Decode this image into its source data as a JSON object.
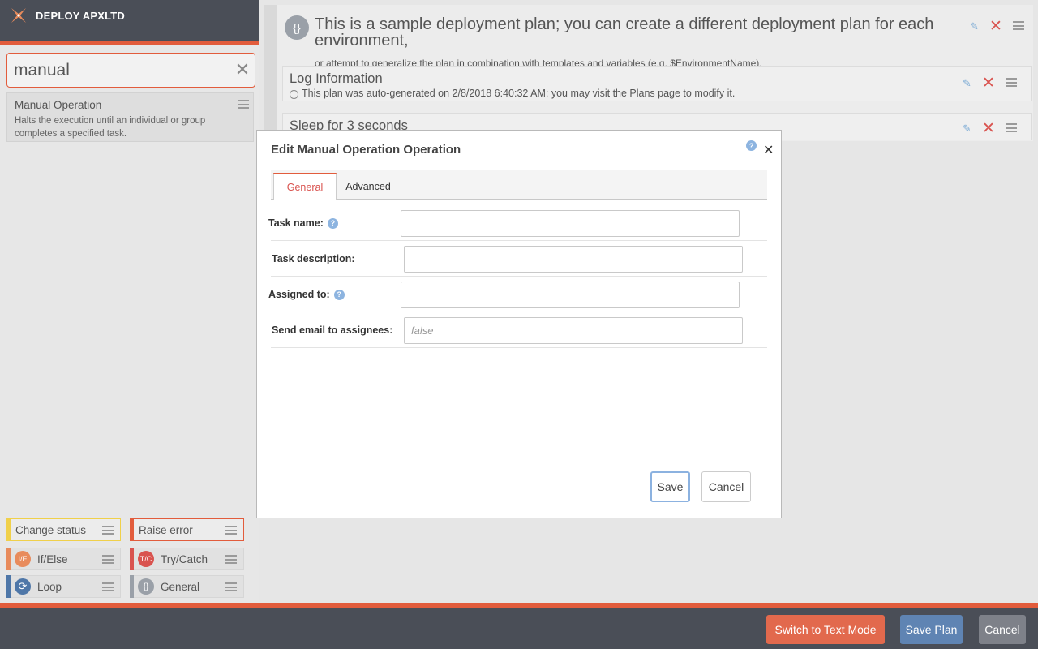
{
  "app": {
    "brand": "DEPLOY APXLTD"
  },
  "search": {
    "value": "manual",
    "clear_icon": "close-icon"
  },
  "results": [
    {
      "title": "Manual Operation",
      "description": "Halts the execution until an individual or group completes a specified task."
    }
  ],
  "palette": [
    {
      "label": "Change status",
      "color": "#f0d04a",
      "icon": null
    },
    {
      "label": "Raise error",
      "color": "#e25c3c",
      "icon": null
    },
    {
      "label": "If/Else",
      "color": "#e88b5c",
      "icon": "I/E"
    },
    {
      "label": "Try/Catch",
      "color": "#d9534f",
      "icon": "T/C"
    },
    {
      "label": "Loop",
      "color": "#4f77a8",
      "icon": "loop"
    },
    {
      "label": "General",
      "color": "#9aa0a8",
      "icon": "{}"
    }
  ],
  "plan": {
    "title": "This is a sample deployment plan; you can create a different deployment plan for each environment,",
    "subtitle": "or attempt to generalize the plan in combination with templates and variables (e.g. $EnvironmentName).",
    "operations": [
      {
        "title": "Log Information",
        "subtitle": "This plan was auto-generated on 2/8/2018 6:40:32 AM; you may visit the Plans page to modify it."
      },
      {
        "title": "Sleep for 3 seconds",
        "subtitle": ""
      }
    ]
  },
  "modal": {
    "title": "Edit Manual Operation Operation",
    "tabs": [
      "General",
      "Advanced"
    ],
    "active_tab": "General",
    "fields": {
      "task_name": {
        "label": "Task name:",
        "value": "",
        "placeholder": ""
      },
      "task_description": {
        "label": "Task description:",
        "value": "",
        "placeholder": ""
      },
      "assigned_to": {
        "label": "Assigned to:",
        "value": "",
        "placeholder": ""
      },
      "send_email": {
        "label": "Send email to assignees:",
        "value": "",
        "placeholder": "false"
      }
    },
    "save_label": "Save",
    "cancel_label": "Cancel"
  },
  "footer": {
    "switch_label": "Switch to Text Mode",
    "save_plan_label": "Save Plan",
    "cancel_label": "Cancel"
  },
  "colors": {
    "accent": "#e25c3c",
    "header": "#4a4e57",
    "save_plan": "#5f84b3",
    "switch_mode": "#e2694d",
    "cancel_footer": "#7e8189"
  }
}
